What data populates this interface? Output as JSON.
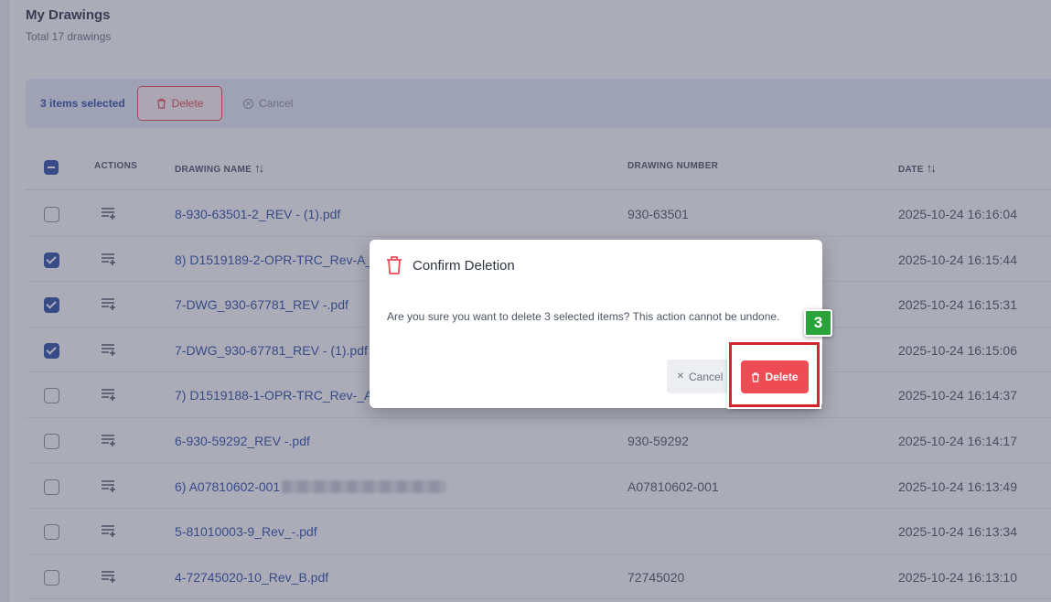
{
  "header": {
    "title": "My Drawings",
    "subtitle": "Total 17 drawings"
  },
  "selection_bar": {
    "count_label": "3 items selected",
    "delete_label": "Delete",
    "cancel_label": "Cancel"
  },
  "table": {
    "columns": {
      "actions": "ACTIONS",
      "name": "DRAWING NAME",
      "number": "DRAWING NUMBER",
      "date": "DATE"
    },
    "rows": [
      {
        "checked": false,
        "name": "8-930-63501-2_REV - (1).pdf",
        "number": "930-63501",
        "date": "2025-10-24 16:16:04"
      },
      {
        "checked": true,
        "name": "8) D1519189-2-OPR-TRC_Rev-A_",
        "number": "",
        "date": "2025-10-24 16:15:44"
      },
      {
        "checked": true,
        "name": "7-DWG_930-67781_REV -.pdf",
        "number": "",
        "date": "2025-10-24 16:15:31"
      },
      {
        "checked": true,
        "name": "7-DWG_930-67781_REV - (1).pdf",
        "number": "",
        "date": "2025-10-24 16:15:06"
      },
      {
        "checked": false,
        "name": "7) D1519188-1-OPR-TRC_Rev-_A",
        "number": "",
        "date": "2025-10-24 16:14:37"
      },
      {
        "checked": false,
        "name": "6-930-59292_REV -.pdf",
        "number": "930-59292",
        "date": "2025-10-24 16:14:17"
      },
      {
        "checked": false,
        "name": "6) A07810602-001",
        "number": "A07810602-001",
        "date": "2025-10-24 16:13:49",
        "blurred": true
      },
      {
        "checked": false,
        "name": "5-81010003-9_Rev_-.pdf",
        "number": "",
        "date": "2025-10-24 16:13:34"
      },
      {
        "checked": false,
        "name": "4-72745020-10_Rev_B.pdf",
        "number": "72745020",
        "date": "2025-10-24 16:13:10"
      }
    ]
  },
  "modal": {
    "title": "Confirm Deletion",
    "message": "Are you sure you want to delete 3 selected items? This action cannot be undone.",
    "cancel_label": "Cancel",
    "delete_label": "Delete"
  },
  "annotation": {
    "step": "3"
  },
  "colors": {
    "primary": "#2b4fa3",
    "danger": "#ef4b55",
    "step_badge": "#2ba33b"
  }
}
